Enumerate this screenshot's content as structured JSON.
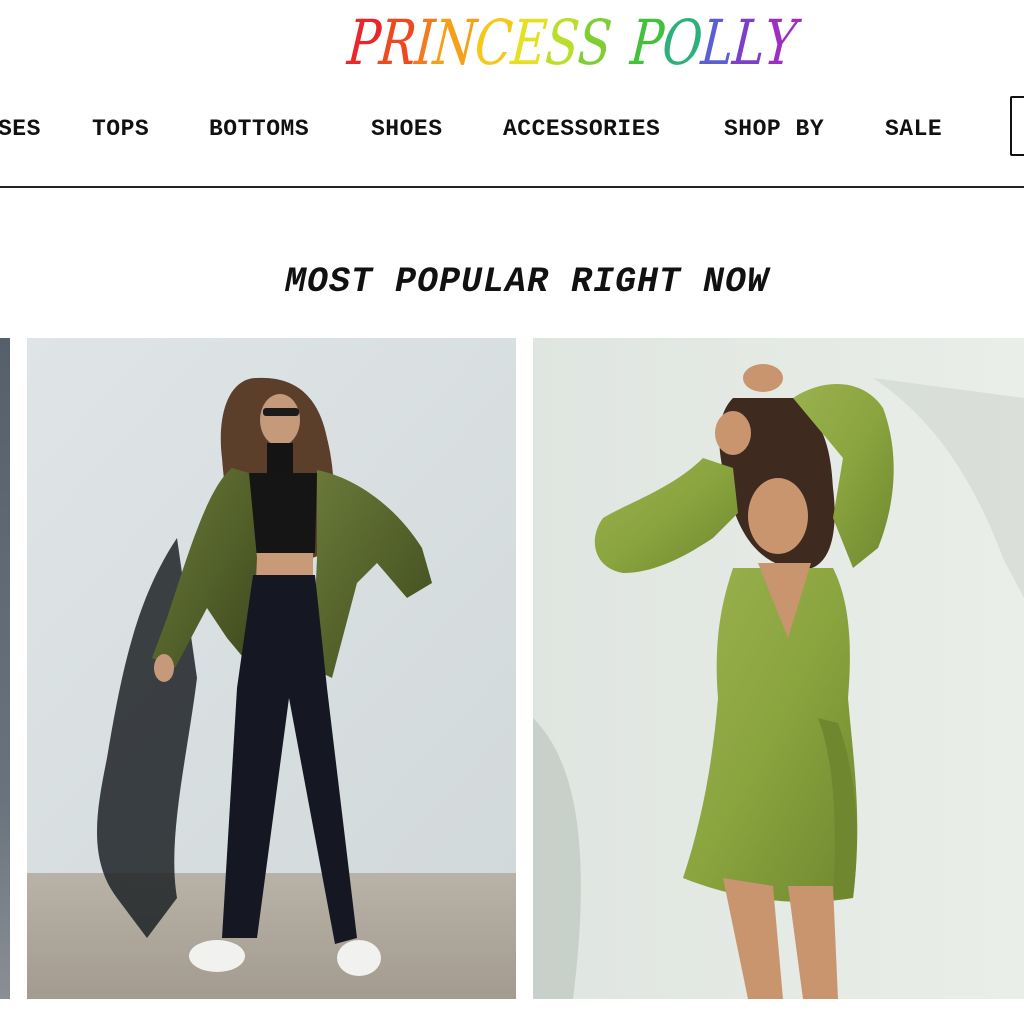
{
  "logo": {
    "letters": [
      {
        "char": "P",
        "color": "#e8262b"
      },
      {
        "char": "R",
        "color": "#ee4a22"
      },
      {
        "char": "I",
        "color": "#f27a1f"
      },
      {
        "char": "N",
        "color": "#f6a019"
      },
      {
        "char": "C",
        "color": "#f6c81c"
      },
      {
        "char": "E",
        "color": "#e6e024"
      },
      {
        "char": "S",
        "color": "#b9de2c"
      },
      {
        "char": "S",
        "color": "#7fcf34"
      },
      {
        "char": " ",
        "color": "#ffffff"
      },
      {
        "char": "P",
        "color": "#43c03c"
      },
      {
        "char": "O",
        "color": "#2eb07a"
      },
      {
        "char": "L",
        "color": "#5b5fd3"
      },
      {
        "char": "L",
        "color": "#7b3fc8"
      },
      {
        "char": "Y",
        "color": "#9b2fc0"
      }
    ]
  },
  "nav": {
    "items": [
      {
        "label": "SES"
      },
      {
        "label": "TOPS"
      },
      {
        "label": "BOTTOMS"
      },
      {
        "label": "SHOES"
      },
      {
        "label": "ACCESSORIES"
      },
      {
        "label": "SHOP BY"
      },
      {
        "label": "SALE"
      }
    ]
  },
  "section": {
    "title": "MOST POPULAR RIGHT NOW"
  },
  "products": [
    {
      "image": "woman-olive-jacket-black-flares",
      "alt": "Model wearing olive leather jacket and black flared pants"
    },
    {
      "image": "woman-olive-wrap-dress",
      "alt": "Model wearing olive green long sleeve wrap mini dress"
    }
  ],
  "colors": {
    "text": "#111111",
    "rule": "#222222",
    "olive": "#7c9b3a",
    "wall": "#dde3e4"
  }
}
